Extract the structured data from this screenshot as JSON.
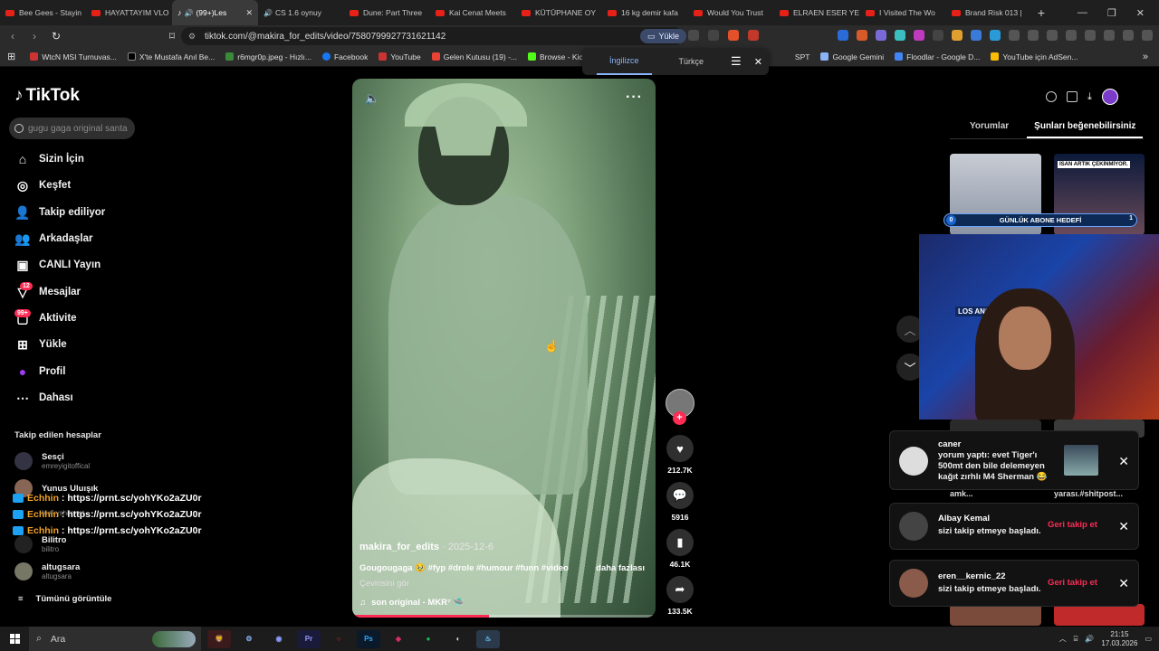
{
  "browser": {
    "tabs": [
      {
        "title": "Bee Gees - Stayin"
      },
      {
        "title": "HAYATTAYIM VLO"
      },
      {
        "title": "(99+)Les",
        "active": true
      },
      {
        "title": "CS 1.6 oynuy"
      },
      {
        "title": "Dune: Part Three"
      },
      {
        "title": "Kai Cenat Meets"
      },
      {
        "title": "KÜTÜPHANE OY"
      },
      {
        "title": "16 kg demir kafa"
      },
      {
        "title": "Would You Trust"
      },
      {
        "title": "ELRAEN ESER YE"
      },
      {
        "title": "I Visited The Wo"
      },
      {
        "title": "Brand Risk 013 |"
      }
    ],
    "new_tab": "+",
    "url": "tiktok.com/@makira_for_edits/video/7580799927731621142",
    "install_label": "Yükle",
    "bookmarks": [
      {
        "label": "WtcN MSI Turnuvas..."
      },
      {
        "label": "X'te Mustafa Anıl Be..."
      },
      {
        "label": "r6mgr0p.jpeg - Hızlı..."
      },
      {
        "label": "Facebook"
      },
      {
        "label": "YouTube"
      },
      {
        "label": "Gelen Kutusu (19) -..."
      },
      {
        "label": "Browse - Kick Stre"
      },
      {
        "label": "SPT"
      },
      {
        "label": "Google Gemini"
      },
      {
        "label": "Floodlar - Google D..."
      },
      {
        "label": "YouTube için AdSen..."
      }
    ],
    "translate": {
      "source": "İngilizce",
      "target": "Türkçe"
    }
  },
  "sidebar": {
    "logo": "TikTok",
    "search_placeholder": "gugu gaga original santa",
    "nav": [
      {
        "label": "Sizin İçin",
        "icon": "home-icon"
      },
      {
        "label": "Keşfet",
        "icon": "compass-icon"
      },
      {
        "label": "Takip ediliyor",
        "icon": "following-icon"
      },
      {
        "label": "Arkadaşlar",
        "icon": "friends-icon"
      },
      {
        "label": "CANLI Yayın",
        "icon": "live-icon"
      },
      {
        "label": "Mesajlar",
        "icon": "messages-icon",
        "badge": "12"
      },
      {
        "label": "Aktivite",
        "icon": "activity-icon",
        "badge": "99+"
      },
      {
        "label": "Yükle",
        "icon": "upload-icon"
      },
      {
        "label": "Profil",
        "icon": "profile-icon"
      },
      {
        "label": "Dahası",
        "icon": "more-icon"
      }
    ],
    "following_header": "Takip edilen hesaplar",
    "accounts": [
      {
        "name": "Sesçi",
        "handle": "emreyigitoffical"
      },
      {
        "name": "Yunus Uluışık",
        "handle": ""
      },
      {
        "name": "",
        "handle": "burkyshitpost"
      },
      {
        "name": "Bilitro",
        "handle": "bilitro"
      },
      {
        "name": "altugsara",
        "handle": "altugsara"
      }
    ],
    "see_all": "Tümünü görüntüle"
  },
  "chat_overlay": {
    "lines": [
      {
        "user": "Echhin",
        "text": " : https://prnt.sc/yohYKo2aZU0r"
      },
      {
        "user": "Echhin",
        "text": " : https://prnt.sc/yohYKo2aZU0r"
      },
      {
        "user": "Echhin",
        "text": " : https://prnt.sc/yohYKo2aZU0r"
      }
    ]
  },
  "video": {
    "username": "makira_for_edits",
    "date": "· 2025-12-6",
    "caption": "Gougougaga 🥹 #fyp #drole #humour #funn #video",
    "more": "daha fazlası",
    "translate": "Çevirisini gör",
    "music": "son original - MKR⁷ 🛸",
    "progress": 0.45
  },
  "actions": {
    "likes": "212.7K",
    "comments": "5916",
    "saves": "46.1K",
    "shares": "133.5K"
  },
  "right_panel": {
    "tabs": [
      {
        "label": "Yorumlar"
      },
      {
        "label": "Şunları beğenebilirsiniz",
        "selected": true
      }
    ],
    "thumb_text": "İSAN ARTIK ÇEKİNMİYOR.",
    "sub_goal": {
      "label": "GÜNLÜK ABONE HEDEFİ",
      "current": "0",
      "target": "1"
    },
    "webcam_sign": "LOS ANGELES",
    "behind_text": [
      "amk...",
      "yarası.#shitpost..."
    ]
  },
  "notifications": [
    {
      "name": "caner",
      "body": "yorum yaptı: evet Tiger'ı 500mt den bile delemeyen kağıt zırhlı M4 Sherman 😂",
      "action": ""
    },
    {
      "name": "Albay Kemal",
      "body": "sizi takip etmeye başladı.",
      "action": "Geri takip et"
    },
    {
      "name": "eren__kernic_22",
      "body": "sizi takip etmeye başladı.",
      "action": "Geri takip et"
    }
  ],
  "taskbar": {
    "search": "Ara",
    "time": "21:15",
    "date": "17.03.2026"
  },
  "colors": {
    "accent": "#fe2c55",
    "bg": "#000000"
  }
}
